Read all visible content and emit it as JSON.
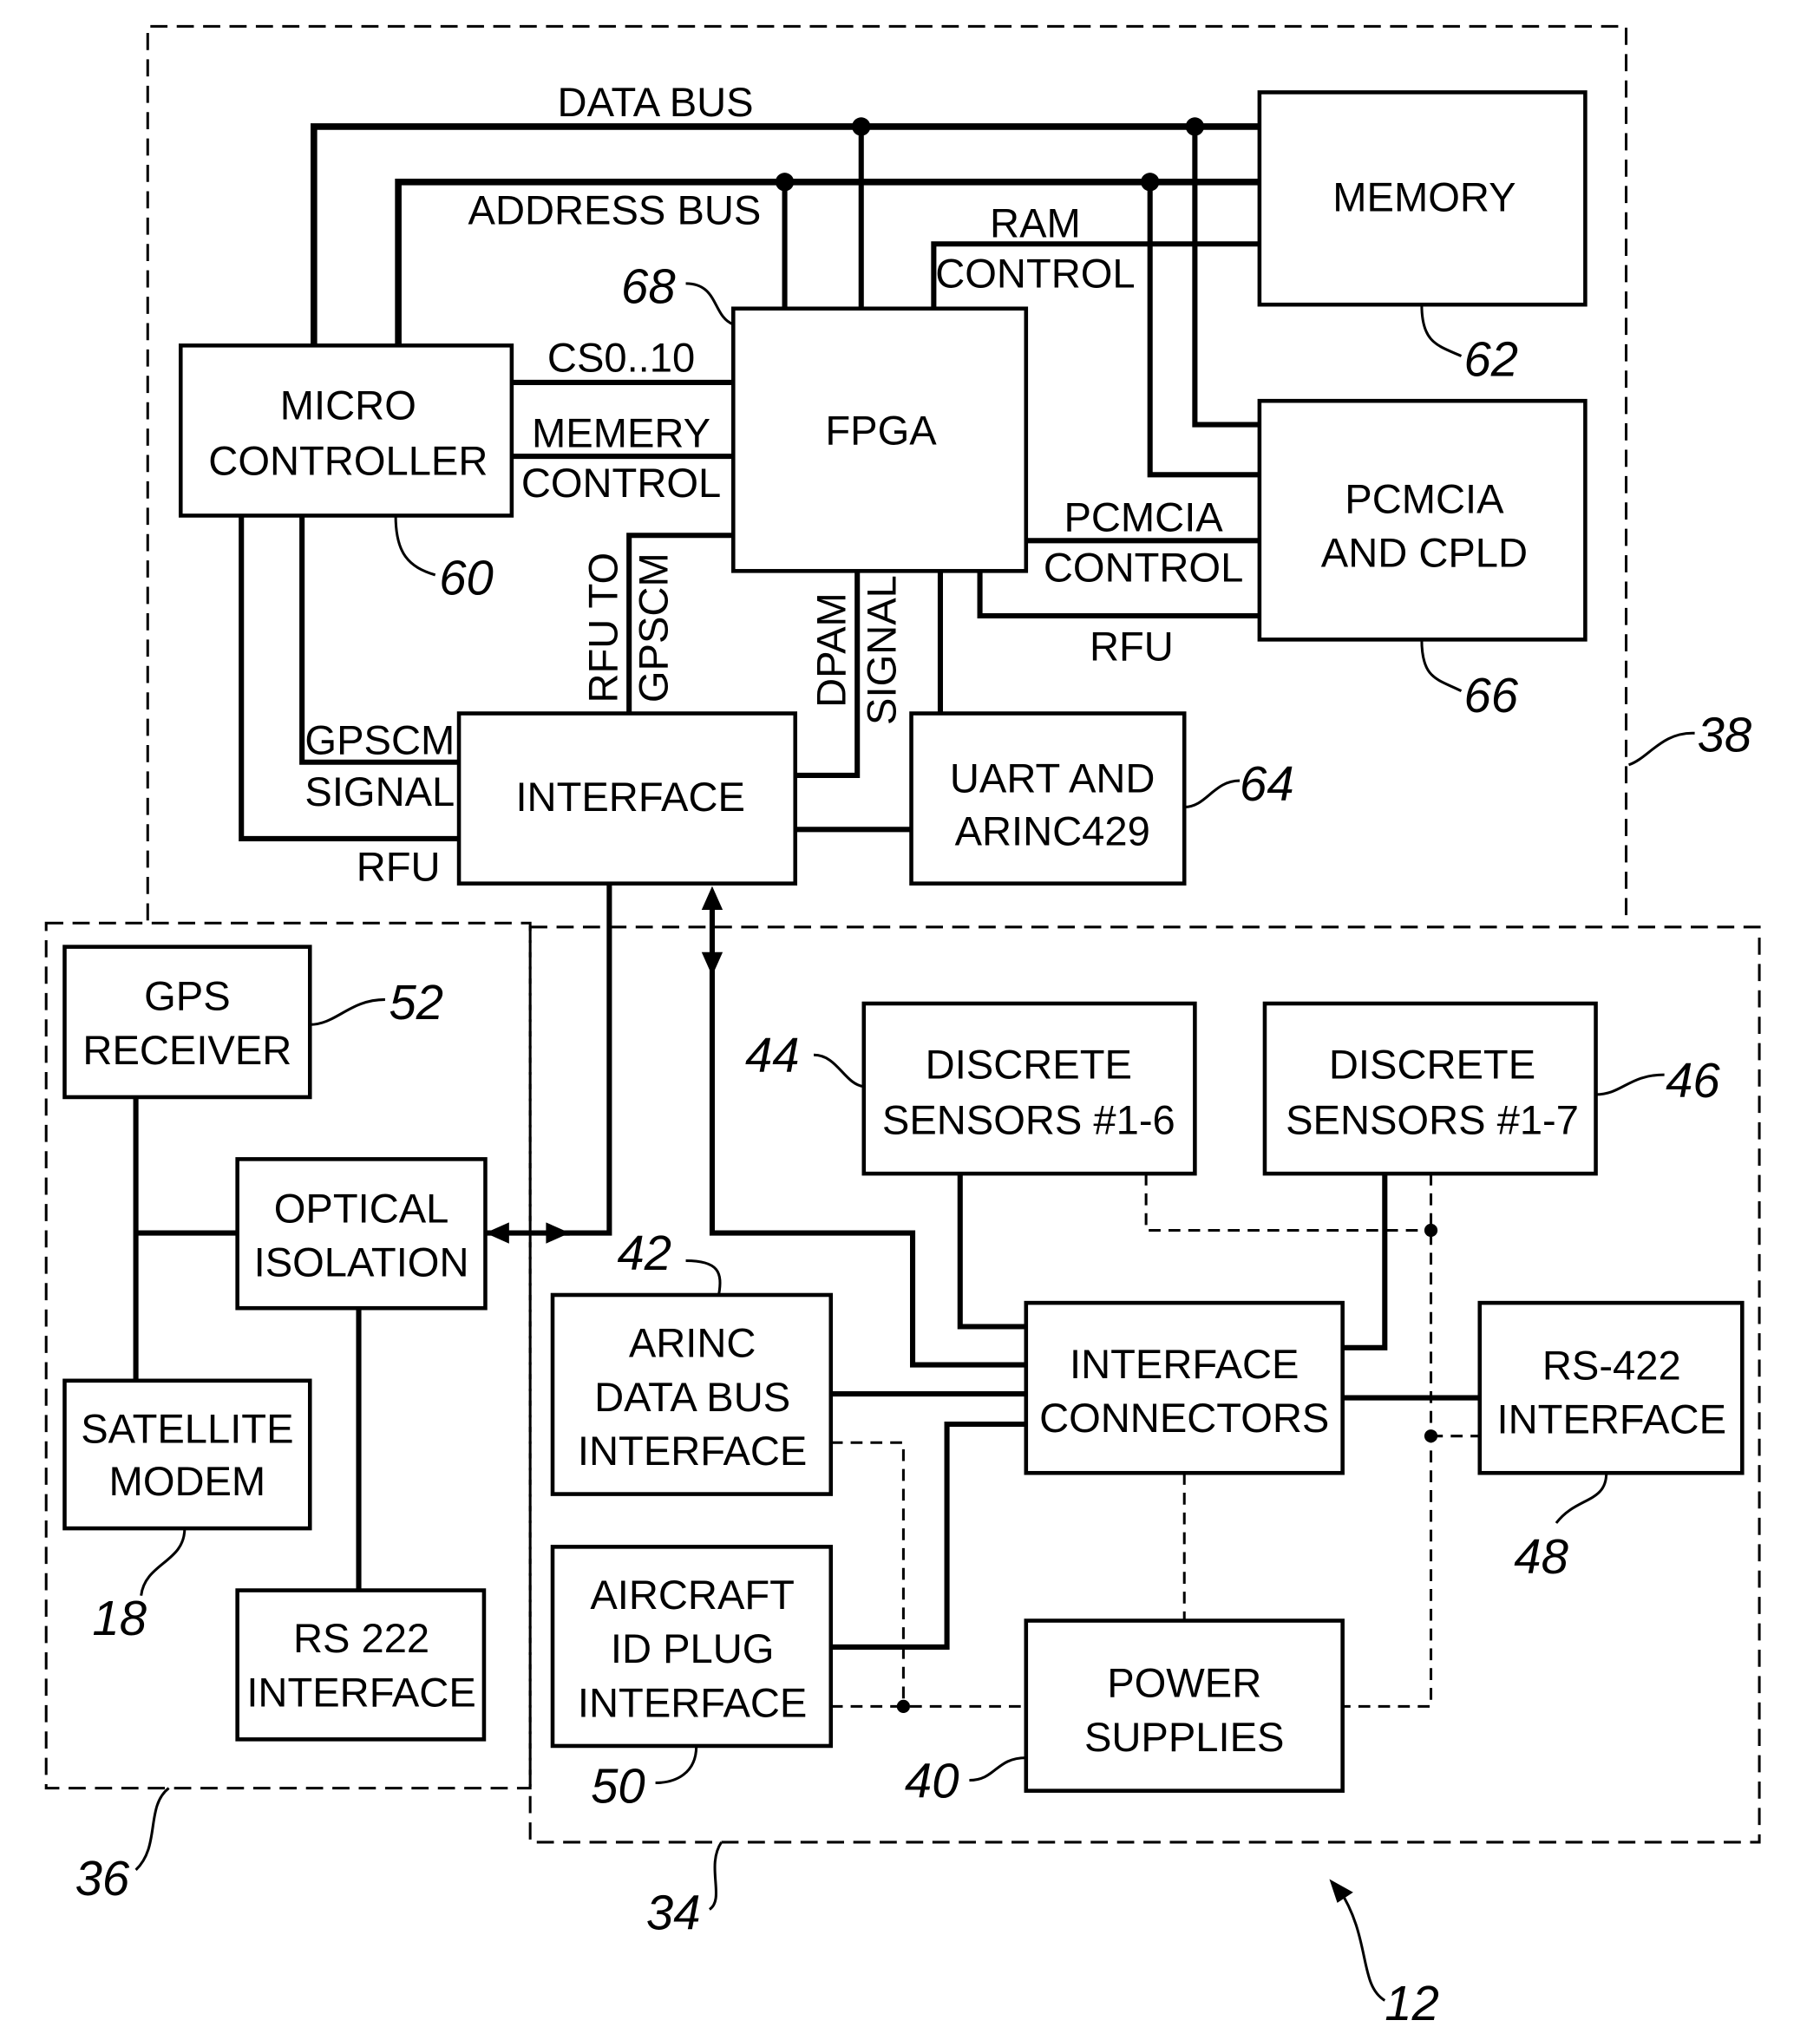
{
  "figure": {
    "enclosures": {
      "e38": "38",
      "e36": "36",
      "e34": "34",
      "system": "12"
    },
    "blocks": {
      "micro": {
        "line1": "MICRO",
        "line2": "CONTROLLER",
        "ref": "60"
      },
      "fpga": {
        "line1": "FPGA",
        "ref": "68"
      },
      "memory": {
        "line1": "MEMORY",
        "ref": "62"
      },
      "pcmcia": {
        "line1": "PCMCIA",
        "line2": "AND CPLD",
        "ref": "66"
      },
      "uart": {
        "line1": "UART AND",
        "line2": "ARINC429",
        "ref": "64"
      },
      "interface": {
        "line1": "INTERFACE"
      },
      "gps": {
        "line1": "GPS",
        "line2": "RECEIVER",
        "ref": "52"
      },
      "optical": {
        "line1": "OPTICAL",
        "line2": "ISOLATION"
      },
      "satmodem": {
        "line1": "SATELLITE",
        "line2": "MODEM",
        "ref": "18"
      },
      "rs222": {
        "line1": "RS 222",
        "line2": "INTERFACE"
      },
      "discrete16": {
        "line1": "DISCRETE",
        "line2": "SENSORS #1-6",
        "ref": "44"
      },
      "discrete17": {
        "line1": "DISCRETE",
        "line2": "SENSORS #1-7",
        "ref": "46"
      },
      "arinc": {
        "line1": "ARINC",
        "line2": "DATA BUS",
        "line3": "INTERFACE",
        "ref": "42"
      },
      "connectors": {
        "line1": "INTERFACE",
        "line2": "CONNECTORS"
      },
      "rs422": {
        "line1": "RS-422",
        "line2": "INTERFACE",
        "ref": "48"
      },
      "aircraftid": {
        "line1": "AIRCRAFT",
        "line2": "ID PLUG",
        "line3": "INTERFACE",
        "ref": "50"
      },
      "power": {
        "line1": "POWER",
        "line2": "SUPPLIES",
        "ref": "40"
      }
    },
    "signals": {
      "data_bus": "DATA BUS",
      "address_bus": "ADDRESS BUS",
      "ram_control_1": "RAM",
      "ram_control_2": "CONTROL",
      "cs": "CS0..10",
      "mem_control_1": "MEMERY",
      "mem_control_2": "CONTROL",
      "pcmcia_control_1": "PCMCIA",
      "pcmcia_control_2": "CONTROL",
      "rfu_fpga": "RFU",
      "rfu_to_gpscm_1": "RFU TO",
      "rfu_to_gpscm_2": "GPSCM",
      "dpam_1": "DPAM",
      "dpam_2": "SIGNAL",
      "gpscm_1": "GPSCM",
      "gpscm_2": "SIGNAL",
      "rfu_micro": "RFU"
    }
  }
}
